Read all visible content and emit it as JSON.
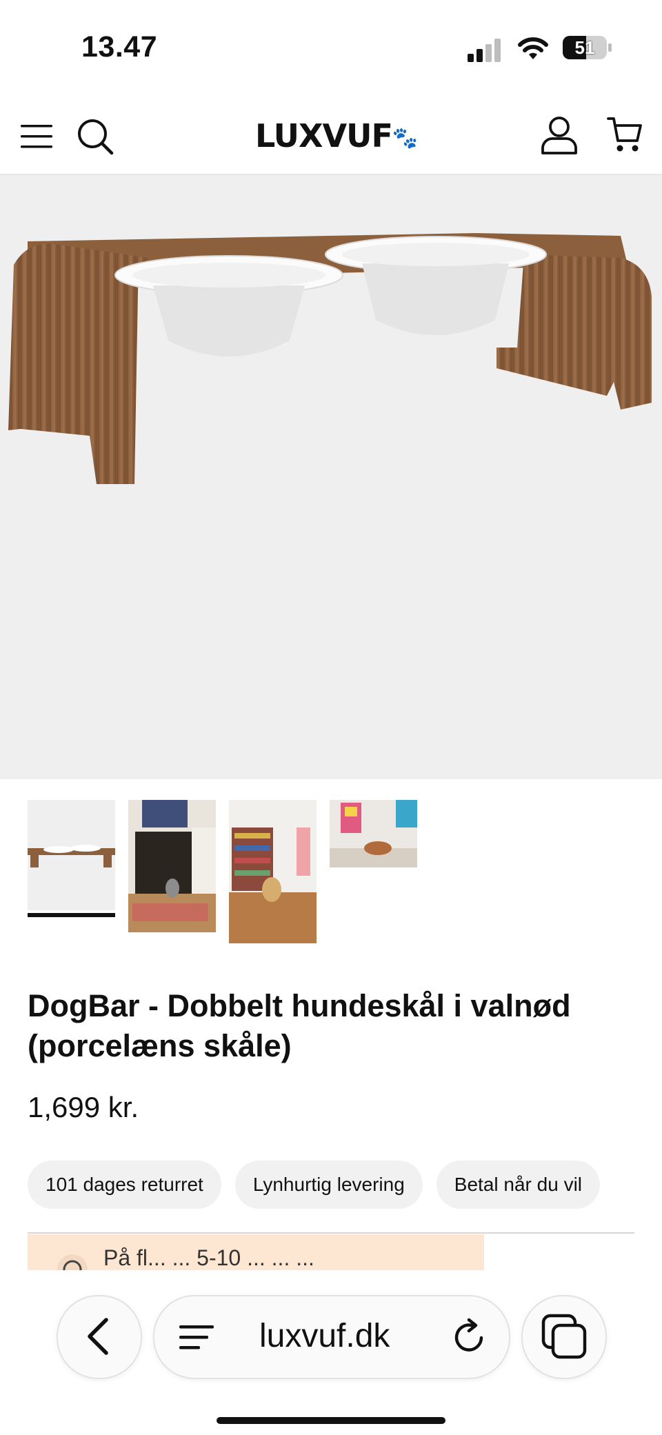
{
  "status_bar": {
    "time": "13.47",
    "battery": "51"
  },
  "header": {
    "logo": "LUXVUF"
  },
  "product": {
    "title": "DogBar - Dobbelt hundeskål i valnød (porcelæns skåle)",
    "price": "1,699 kr.",
    "thumbnail_count": 4,
    "active_thumbnail": 1
  },
  "chips": [
    "101 dages returret",
    "Lynhurtig levering",
    "Betal når du vil"
  ],
  "notice": {
    "text": "På fl... ... 5-10 ... ... ..."
  },
  "browser": {
    "url": "luxvuf.dk"
  },
  "colors": {
    "notice_bg": "#fde6d2",
    "hero_bg": "#efefef",
    "wood": "#8a5e3c"
  }
}
